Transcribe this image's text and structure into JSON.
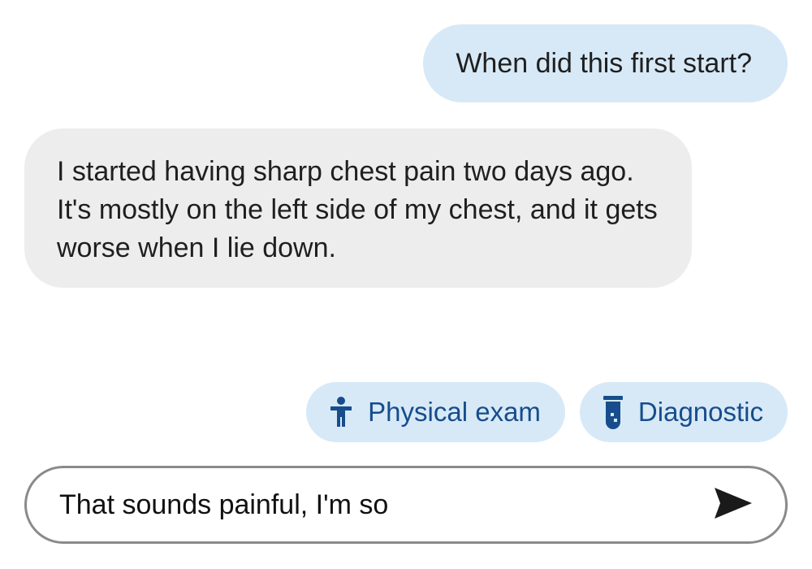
{
  "conversation": {
    "messages": [
      {
        "role": "outgoing",
        "text": "When did this first start?"
      },
      {
        "role": "incoming",
        "text": "I started having sharp chest pain two days ago. It's mostly on the left side of my chest, and it gets worse when I lie down."
      }
    ]
  },
  "suggestions": [
    {
      "label": "Physical exam",
      "icon": "person-icon"
    },
    {
      "label": "Diagnostic",
      "icon": "test-tube-icon"
    }
  ],
  "composer": {
    "value": "That sounds painful, I'm so",
    "send_icon": "send-icon"
  },
  "colors": {
    "outgoing_bubble": "#d7e9f7",
    "incoming_bubble": "#ededed",
    "chip_text": "#174d8c",
    "composer_border": "#8a8a8a"
  }
}
